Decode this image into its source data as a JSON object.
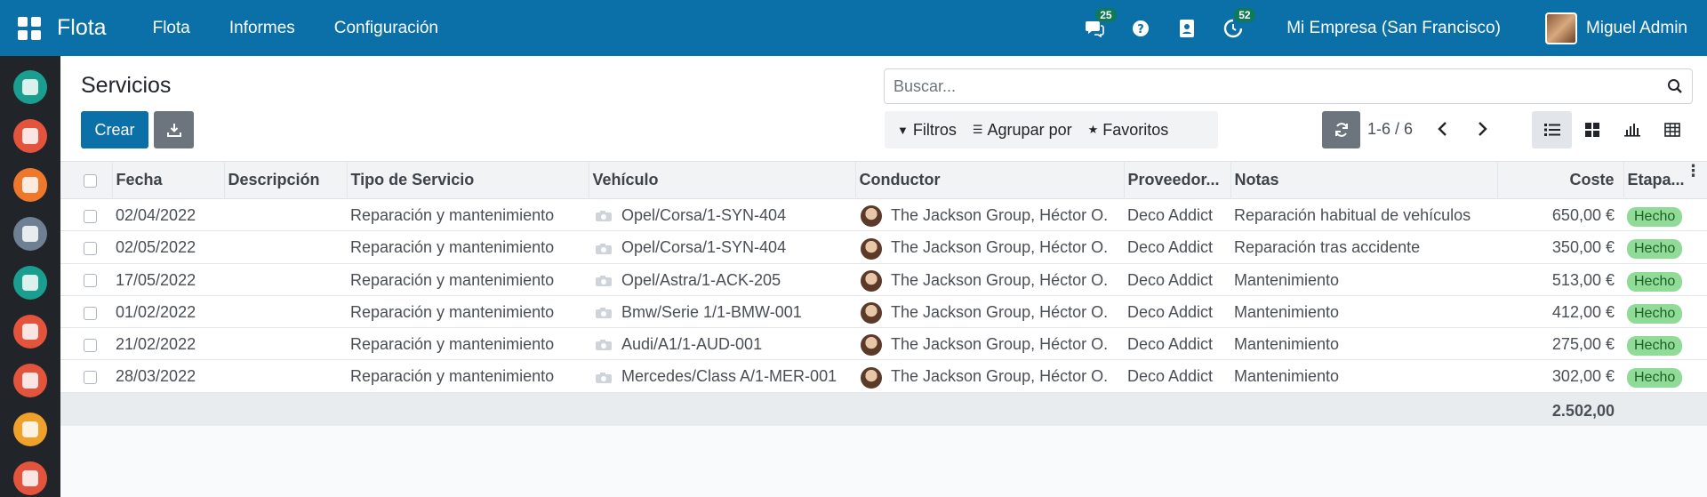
{
  "navbar": {
    "brand": "Flota",
    "menu": [
      "Flota",
      "Informes",
      "Configuración"
    ],
    "messages_count": "25",
    "activity_count": "52",
    "company": "Mi Empresa (San Francisco)",
    "user": "Miguel Admin"
  },
  "sidebar": {
    "apps": [
      {
        "name": "discuss",
        "color": "#1a9e8f"
      },
      {
        "name": "calendar",
        "color": "#e4533c"
      },
      {
        "name": "notes",
        "color": "#f0782b"
      },
      {
        "name": "contacts",
        "color": "#6f7f94"
      },
      {
        "name": "crm",
        "color": "#1a9e8f"
      },
      {
        "name": "sales",
        "color": "#e4533c"
      },
      {
        "name": "dashboards",
        "color": "#e4533c"
      },
      {
        "name": "employees",
        "color": "#f0a12b"
      },
      {
        "name": "fleet",
        "color": "#e4533c"
      }
    ]
  },
  "control_panel": {
    "title": "Servicios",
    "create_label": "Crear",
    "search_placeholder": "Buscar...",
    "filters_label": "Filtros",
    "group_by_label": "Agrupar por",
    "favorites_label": "Favoritos",
    "pager": "1-6 / 6"
  },
  "table": {
    "headers": {
      "fecha": "Fecha",
      "descripcion": "Descripción",
      "tipo": "Tipo de Servicio",
      "vehiculo": "Vehículo",
      "conductor": "Conductor",
      "proveedor": "Proveedor...",
      "notas": "Notas",
      "coste": "Coste",
      "etapa": "Etapa..."
    },
    "rows": [
      {
        "fecha": "02/04/2022",
        "descripcion": "",
        "tipo": "Reparación y mantenimiento",
        "vehiculo": "Opel/Corsa/1-SYN-404",
        "conductor": "The Jackson Group, Héctor O.",
        "proveedor": "Deco Addict",
        "notas": "Reparación habitual de vehículos",
        "coste": "650,00 €",
        "etapa": "Hecho"
      },
      {
        "fecha": "02/05/2022",
        "descripcion": "",
        "tipo": "Reparación y mantenimiento",
        "vehiculo": "Opel/Corsa/1-SYN-404",
        "conductor": "The Jackson Group, Héctor O.",
        "proveedor": "Deco Addict",
        "notas": "Reparación tras accidente",
        "coste": "350,00 €",
        "etapa": "Hecho"
      },
      {
        "fecha": "17/05/2022",
        "descripcion": "",
        "tipo": "Reparación y mantenimiento",
        "vehiculo": "Opel/Astra/1-ACK-205",
        "conductor": "The Jackson Group, Héctor O.",
        "proveedor": "Deco Addict",
        "notas": "Mantenimiento",
        "coste": "513,00 €",
        "etapa": "Hecho"
      },
      {
        "fecha": "01/02/2022",
        "descripcion": "",
        "tipo": "Reparación y mantenimiento",
        "vehiculo": "Bmw/Serie 1/1-BMW-001",
        "conductor": "The Jackson Group, Héctor O.",
        "proveedor": "Deco Addict",
        "notas": "Mantenimiento",
        "coste": "412,00 €",
        "etapa": "Hecho"
      },
      {
        "fecha": "21/02/2022",
        "descripcion": "",
        "tipo": "Reparación y mantenimiento",
        "vehiculo": "Audi/A1/1-AUD-001",
        "conductor": "The Jackson Group, Héctor O.",
        "proveedor": "Deco Addict",
        "notas": "Mantenimiento",
        "coste": "275,00 €",
        "etapa": "Hecho"
      },
      {
        "fecha": "28/03/2022",
        "descripcion": "",
        "tipo": "Reparación y mantenimiento",
        "vehiculo": "Mercedes/Class A/1-MER-001",
        "conductor": "The Jackson Group, Héctor O.",
        "proveedor": "Deco Addict",
        "notas": "Mantenimiento",
        "coste": "302,00 €",
        "etapa": "Hecho"
      }
    ],
    "total_cost": "2.502,00"
  }
}
